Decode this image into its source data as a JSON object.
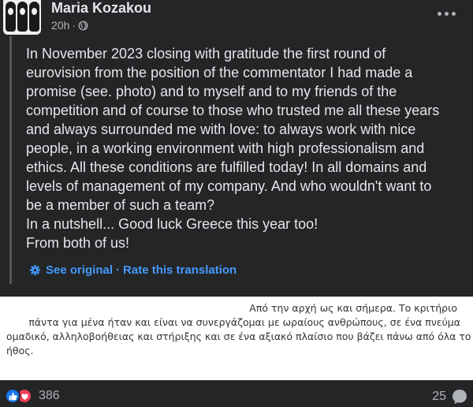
{
  "post": {
    "author": "Maria Kozakou",
    "time": "20h",
    "separator": "·",
    "privacy_icon": "globe-icon",
    "more_icon": "more-horizontal-icon"
  },
  "translation": {
    "text": "In November 2023 closing with gratitude the first round of\neurovision from the position of the commentator I had made a\npromise (see. photo) and to myself and to my friends of the\ncompetition and of course to those who trusted me all these years\nand always surrounded me with love: to always work with nice\npeople, in a working environment with high professionalism and\nethics. All these conditions are fulfilled today! In all domains and\nlevels of management of my company. And who wouldn't want to\nbe a member of such a team?\nIn a nutshell... Good luck Greece this year too!\nFrom both of us!",
    "see_original": "See original",
    "separator": "·",
    "rate": "Rate this translation",
    "icon": "gear-icon"
  },
  "photo": {
    "line1": "Από την αρχή ως και σήμερα. Το κριτήριο",
    "line2": "πάντα για μένα ήταν και είναι να συνεργάζομαι με ωραίους ανθρώπους, σε ένα πνεύμα",
    "line3": "ομαδικό, αλληλοβοήθειας και στήριξης και σε ένα αξιακό πλαίσιο που βάζει πάνω από όλα το",
    "line4": "ήθος."
  },
  "footer": {
    "reaction_count": "386",
    "comment_count": "25",
    "colors": {
      "like": "#1877f2",
      "love": "#f33e58",
      "link": "#4599ff"
    }
  }
}
